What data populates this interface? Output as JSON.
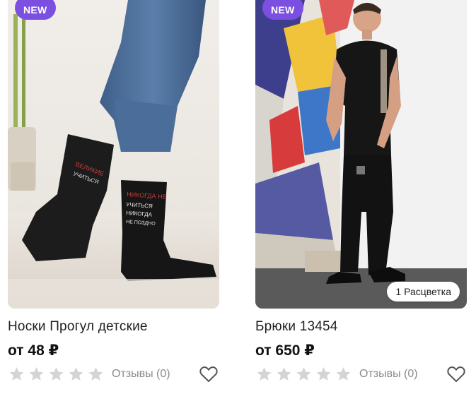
{
  "products": [
    {
      "badge_new": "NEW",
      "title": "Носки Прогул детские",
      "price": "от 48 ₽",
      "rating": 0,
      "reviews_label": "Отзывы (0)",
      "colors_badge": ""
    },
    {
      "badge_new": "NEW",
      "title": "Брюки 13454",
      "price": "от 650 ₽",
      "rating": 0,
      "reviews_label": "Отзывы (0)",
      "colors_badge": "1 Расцветка"
    }
  ],
  "colors": {
    "badge_new_bg": "#7b4fe0",
    "star_empty": "#d4d4d4",
    "text_muted": "#8a8a8a"
  },
  "icons": {
    "rating": "star-icon",
    "favorite": "heart-outline-icon"
  }
}
